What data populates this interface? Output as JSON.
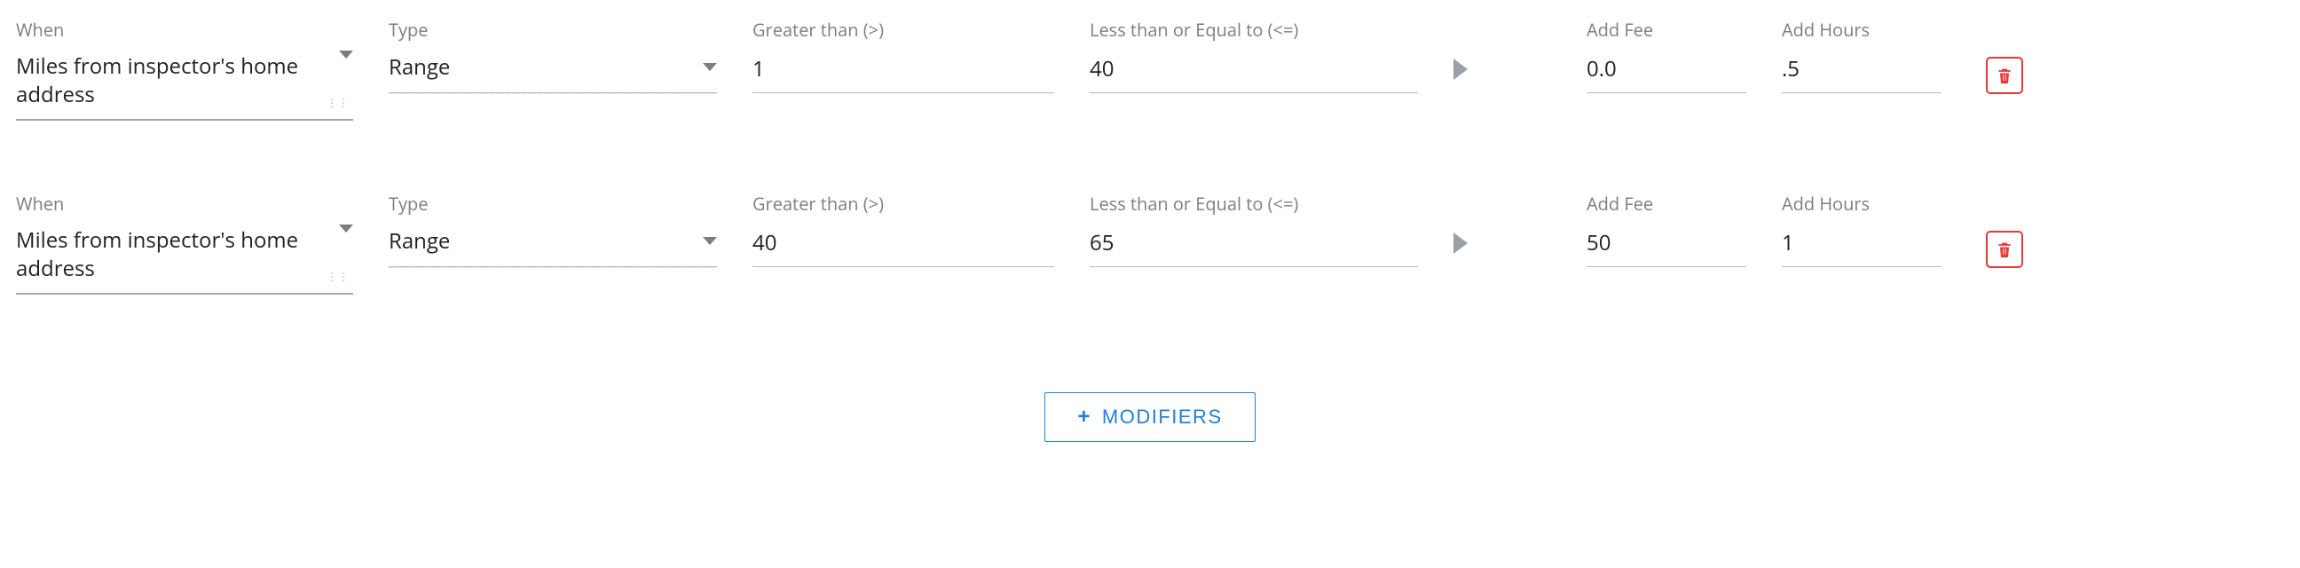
{
  "labels": {
    "when": "When",
    "type": "Type",
    "gt": "Greater than (>)",
    "lte": "Less than or Equal to (<=)",
    "fee": "Add Fee",
    "hours": "Add Hours"
  },
  "rows": [
    {
      "when": "Miles from inspector's home address",
      "type": "Range",
      "gt": "1",
      "lte": "40",
      "fee": "0.0",
      "hours": ".5"
    },
    {
      "when": "Miles from inspector's home address",
      "type": "Range",
      "gt": "40",
      "lte": "65",
      "fee": "50",
      "hours": "1"
    }
  ],
  "button": {
    "modifiers": "MODIFIERS"
  }
}
